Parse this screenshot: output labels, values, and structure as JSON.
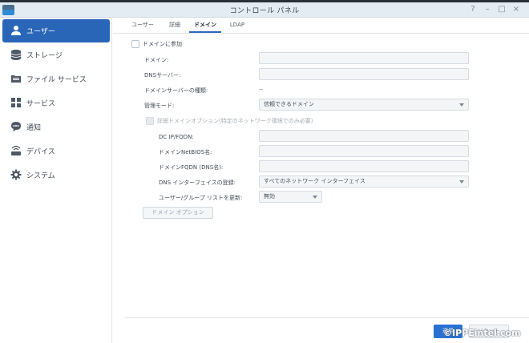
{
  "window": {
    "title": "コントロール パネル",
    "controls": [
      "?",
      "–",
      "□",
      "×"
    ]
  },
  "sidebar": {
    "items": [
      {
        "label": "ユーザー",
        "icon": "user-icon",
        "active": true
      },
      {
        "label": "ストレージ",
        "icon": "storage-icon"
      },
      {
        "label": "ファイル サービス",
        "icon": "file-services-icon"
      },
      {
        "label": "サービス",
        "icon": "services-icon"
      },
      {
        "label": "通知",
        "icon": "notification-icon"
      },
      {
        "label": "デバイス",
        "icon": "device-icon"
      },
      {
        "label": "システム",
        "icon": "system-gear-icon"
      }
    ]
  },
  "tabs": [
    "ユーザー",
    "詳細",
    "ドメイン",
    "LDAP"
  ],
  "form": {
    "join_domain": "ドメインに参加",
    "domain_label": "ドメイン:",
    "dns_label": "DNSサーバー:",
    "server_type_label": "ドメインサーバーの種類:",
    "server_type_value": "--",
    "mode_label": "管理モード:",
    "mode_value": "信頼できるドメイン",
    "advanced_option": "詳細ドメインオプション(特定のネットワーク環境でのみ必要)",
    "dc_label": "DC IP/FQDN:",
    "netbios_label": "ドメインNetBIOS名:",
    "fqdn_label": "ドメインFQDN (DNS名):",
    "dns_register_label": "DNS インターフェイスの登録:",
    "dns_register_value": "すべてのネットワーク インターフェイス",
    "refresh_label": "ユーザー/グループ リストを更新:",
    "refresh_value": "無効",
    "domain_options_button": "ドメイン オプション"
  },
  "footer": {
    "apply": "適用",
    "reset": "リセット"
  },
  "watermark": "©IPPEintel.com",
  "colors": {
    "accent": "#2a66b8",
    "apply": "#2a72d2",
    "titlebar": "#e4ecf3"
  }
}
